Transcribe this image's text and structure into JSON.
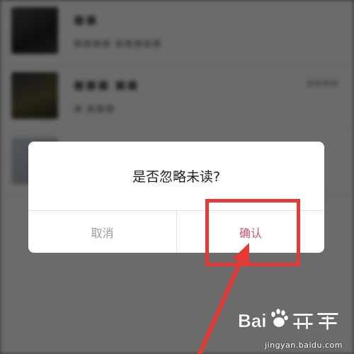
{
  "dialog": {
    "title": "是否忽略未读?",
    "cancel_label": "取消",
    "confirm_label": "确认"
  },
  "watermark": {
    "url": "jingyan.baidu.com"
  },
  "colors": {
    "confirm_text": "#d2556f",
    "cancel_text": "#9a9a9a",
    "annotation_red": "#e53a33",
    "overlay": "rgba(0,0,0,0.56)"
  }
}
